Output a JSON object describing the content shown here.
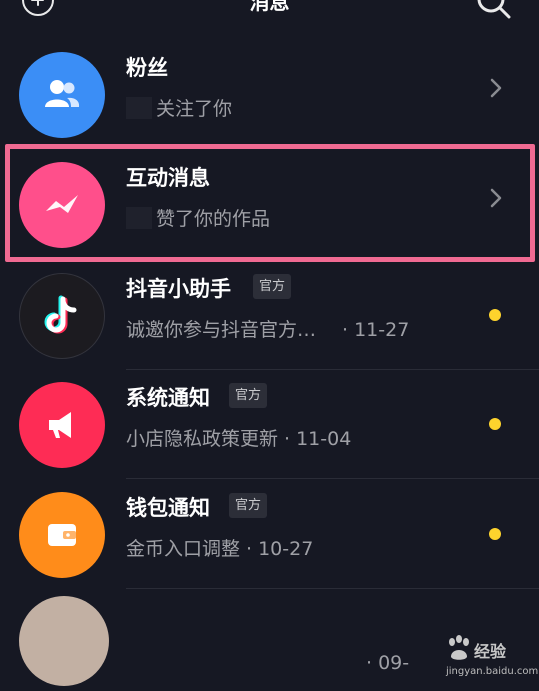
{
  "header": {
    "title": "消息",
    "add_icon": "plus-circle-icon",
    "search_icon": "search-icon"
  },
  "rows": [
    {
      "name": "粉丝",
      "subtitle": "关注了你",
      "icon": "fans-icon",
      "color": "#3b8ef6"
    },
    {
      "name": "互动消息",
      "subtitle": "赞了你的作品",
      "icon": "interaction-icon",
      "color": "#ff4f8b"
    },
    {
      "name": "抖音小助手",
      "badge": "官方",
      "subtitle": "诚邀你参与抖音官方…",
      "time": "· 11-27",
      "icon": "tiktok-icon",
      "color": "#1c1b20"
    },
    {
      "name": "系统通知",
      "badge": "官方",
      "subtitle": "小店隐私政策更新",
      "time": "· 11-04",
      "icon": "megaphone-icon",
      "color": "#fe2c55"
    },
    {
      "name": "钱包通知",
      "badge": "官方",
      "subtitle": "金币入口调整",
      "time": "· 10-27",
      "icon": "wallet-icon",
      "color": "#ff8c1a"
    },
    {
      "time": "· 09-",
      "color": "#c2b0a3"
    }
  ],
  "unread_dot_color": "#fdd32d",
  "highlight_color": "#f06a92",
  "watermark": {
    "text": "经验",
    "url": "jingyan.baidu.com"
  }
}
